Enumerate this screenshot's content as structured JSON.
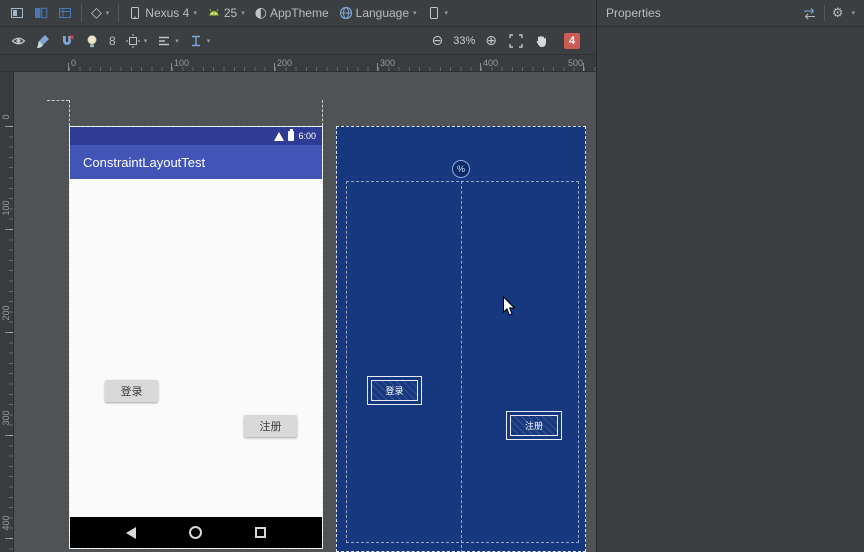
{
  "main_toolbar": {
    "device_label": "Nexus 4",
    "api_label": "25",
    "theme_label": "AppTheme",
    "language_label": "Language"
  },
  "design_toolbar": {
    "default_margin": "8",
    "zoom_out": "⊖",
    "zoom_level": "33%",
    "zoom_in": "⊕",
    "error_count": "4"
  },
  "rulers": {
    "horizontal": [
      "0",
      "100",
      "200",
      "300",
      "400",
      "500"
    ],
    "vertical": [
      "0",
      "100",
      "200",
      "300",
      "400"
    ]
  },
  "design_view": {
    "status_time": "6:00",
    "app_bar_title": "ConstraintLayoutTest",
    "login_button": "登录",
    "register_button": "注册"
  },
  "blueprint_view": {
    "percent_badge": "%",
    "login_button": "登录",
    "register_button": "注册"
  },
  "properties_panel": {
    "title": "Properties",
    "gear_glyph": "⚙"
  },
  "icons": {
    "variant_diamond": "◇",
    "theme_circle": "◐",
    "dropdown_arrow": "▾"
  },
  "colors": {
    "app_bar": "#4254b5",
    "status_bar": "#2f3c96",
    "blueprint_bg": "#17387e",
    "error_badge": "#cc5b56",
    "toolbar_bg": "#3c3f41",
    "canvas_bg": "#505355"
  }
}
